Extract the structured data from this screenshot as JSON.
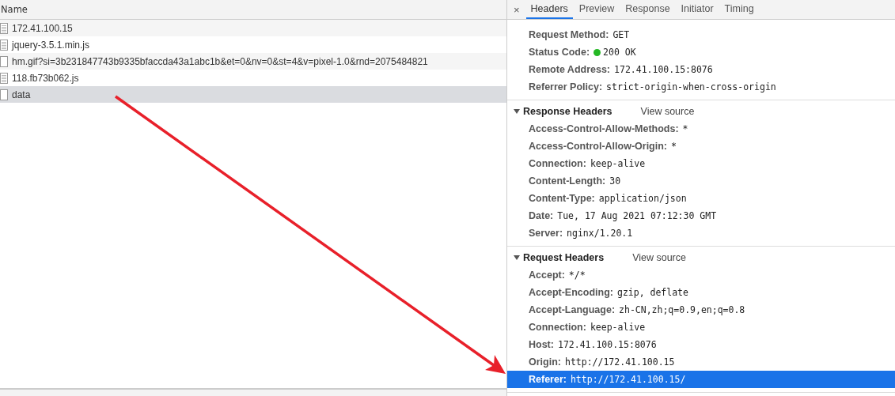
{
  "request_list": {
    "column": "Name",
    "rows": [
      {
        "name": "172.41.100.15",
        "kind": "document",
        "selected": false
      },
      {
        "name": "jquery-3.5.1.min.js",
        "kind": "document",
        "selected": false
      },
      {
        "name": "hm.gif?si=3b231847743b9335bfaccda43a1abc1b&et=0&nv=0&st=4&v=pixel-1.0&rnd=2075484821",
        "kind": "blank",
        "selected": false
      },
      {
        "name": "118.fb73b062.js",
        "kind": "document",
        "selected": false
      },
      {
        "name": "data",
        "kind": "blank",
        "selected": true
      }
    ]
  },
  "details": {
    "close": "×",
    "tabs": [
      {
        "label": "Headers",
        "selected": true
      },
      {
        "label": "Preview",
        "selected": false
      },
      {
        "label": "Response",
        "selected": false
      },
      {
        "label": "Initiator",
        "selected": false
      },
      {
        "label": "Timing",
        "selected": false
      }
    ],
    "general": [
      {
        "name": "Request Method:",
        "value": "GET",
        "kind": "plain"
      },
      {
        "name": "Status Code:",
        "value": "200 OK",
        "kind": "status"
      },
      {
        "name": "Remote Address:",
        "value": "172.41.100.15:8076",
        "kind": "plain"
      },
      {
        "name": "Referrer Policy:",
        "value": "strict-origin-when-cross-origin",
        "kind": "plain"
      }
    ],
    "sections": [
      {
        "title": "Response Headers",
        "expanded": true,
        "link": "View source",
        "headers": [
          {
            "name": "Access-Control-Allow-Methods:",
            "value": "*",
            "selected": false
          },
          {
            "name": "Access-Control-Allow-Origin:",
            "value": "*",
            "selected": false
          },
          {
            "name": "Connection:",
            "value": "keep-alive",
            "selected": false
          },
          {
            "name": "Content-Length:",
            "value": "30",
            "selected": false
          },
          {
            "name": "Content-Type:",
            "value": "application/json",
            "selected": false
          },
          {
            "name": "Date:",
            "value": "Tue, 17 Aug 2021 07:12:30 GMT",
            "selected": false
          },
          {
            "name": "Server:",
            "value": "nginx/1.20.1",
            "selected": false
          }
        ]
      },
      {
        "title": "Request Headers",
        "expanded": true,
        "link": "View source",
        "headers": [
          {
            "name": "Accept:",
            "value": "*/*",
            "selected": false
          },
          {
            "name": "Accept-Encoding:",
            "value": "gzip, deflate",
            "selected": false
          },
          {
            "name": "Accept-Language:",
            "value": "zh-CN,zh;q=0.9,en;q=0.8",
            "selected": false
          },
          {
            "name": "Connection:",
            "value": "keep-alive",
            "selected": false
          },
          {
            "name": "Host:",
            "value": "172.41.100.15:8076",
            "selected": false
          },
          {
            "name": "Origin:",
            "value": "http://172.41.100.15",
            "selected": false
          },
          {
            "name": "Referer:",
            "value": "http://172.41.100.15/",
            "selected": true
          }
        ]
      }
    ]
  }
}
